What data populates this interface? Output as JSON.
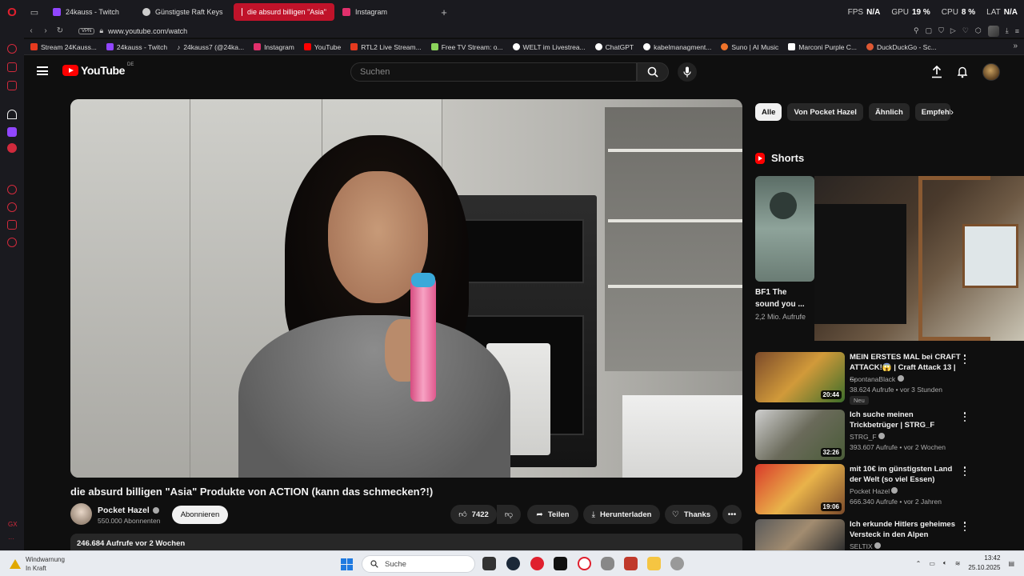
{
  "browser": {
    "tabs": [
      {
        "label": "24kauss - Twitch",
        "color": "#9146ff",
        "active": false
      },
      {
        "label": "Günstigste Raft Keys",
        "color": "#cccccc",
        "active": false
      },
      {
        "label": "die absurd billigen \"Asia\"",
        "color": "#ff0000",
        "active": true
      },
      {
        "label": "Instagram",
        "color": "#e1306c",
        "active": false
      }
    ],
    "stats": {
      "fps_label": "FPS",
      "fps_value": "N/A",
      "gpu_label": "GPU",
      "gpu_value": "19 %",
      "cpu_label": "CPU",
      "cpu_value": "8 %",
      "lat_label": "LAT",
      "lat_value": "N/A"
    },
    "vpn_label": "VPN",
    "url": "www.youtube.com/watch",
    "bookmarks": [
      {
        "label": "Stream 24Kauss...",
        "color": "#e63a1f"
      },
      {
        "label": "24kauss - Twitch",
        "color": "#9146ff"
      },
      {
        "label": "24kauss7 (@24ka...",
        "color": "#000000"
      },
      {
        "label": "Instagram",
        "color": "#e1306c"
      },
      {
        "label": "YouTube",
        "color": "#ff0000"
      },
      {
        "label": "RTL2 Live Stream...",
        "color": "#e63a1f"
      },
      {
        "label": "Free TV Stream: o...",
        "color": "#8bd35b"
      },
      {
        "label": "WELT im Livestrea...",
        "color": "#ffffff"
      },
      {
        "label": "ChatGPT",
        "color": "#ffffff"
      },
      {
        "label": "kabelmanagment...",
        "color": "#ffffff"
      },
      {
        "label": "Suno | AI Music",
        "color": "#f0742b"
      },
      {
        "label": "Marconi Purple C...",
        "color": "#ffffff"
      },
      {
        "label": "DuckDuckGo - Sc...",
        "color": "#de5833"
      }
    ],
    "sidebar_gx_label": "GX"
  },
  "youtube": {
    "logo_text": "YouTube",
    "region": "DE",
    "search_placeholder": "Suchen",
    "video": {
      "title": "die absurd billigen \"Asia\" Produkte von ACTION (kann das schmecken?!)",
      "channel": "Pocket Hazel",
      "subscribers": "550.000 Abonnenten",
      "subscribe_label": "Abonnieren",
      "likes": "7422",
      "share_label": "Teilen",
      "download_label": "Herunterladen",
      "thanks_label": "Thanks",
      "views_date": "246.684 Aufrufe  vor 2 Wochen"
    },
    "chips": [
      "Alle",
      "Von Pocket Hazel",
      "Ähnlich",
      "Empfehlungen"
    ],
    "shorts_label": "Shorts",
    "short": {
      "title": "BF1 The sound you ...",
      "views": "2,2 Mio. Aufrufe"
    },
    "recommendations": [
      {
        "title": "MEIN ERSTES MAL bei CRAFT ATTACK!😱 | Craft Attack 13 | ...",
        "channel": "SpontanaBlack",
        "meta": "38.624 Aufrufe • vor 3 Stunden",
        "duration": "20:44",
        "badge": "Neu"
      },
      {
        "title": "Ich suche meinen Trickbetrüger | STRG_F",
        "channel": "STRG_F",
        "meta": "393.607 Aufrufe • vor 2 Wochen",
        "duration": "32:26",
        "badge": ""
      },
      {
        "title": "mit 10€ im günstigsten Land der Welt (so viel Essen)",
        "channel": "Pocket Hazel",
        "meta": "666.340 Aufrufe • vor 2 Jahren",
        "duration": "19:06",
        "badge": ""
      },
      {
        "title": "Ich erkunde Hitlers geheimes Versteck in den Alpen",
        "channel": "SELTIX",
        "meta": "",
        "duration": "",
        "badge": ""
      }
    ]
  },
  "taskbar": {
    "weather_line1": "Windwarnung",
    "weather_line2": "In Kraft",
    "search_placeholder": "Suche",
    "time": "13:42",
    "date": "25.10.2025"
  }
}
